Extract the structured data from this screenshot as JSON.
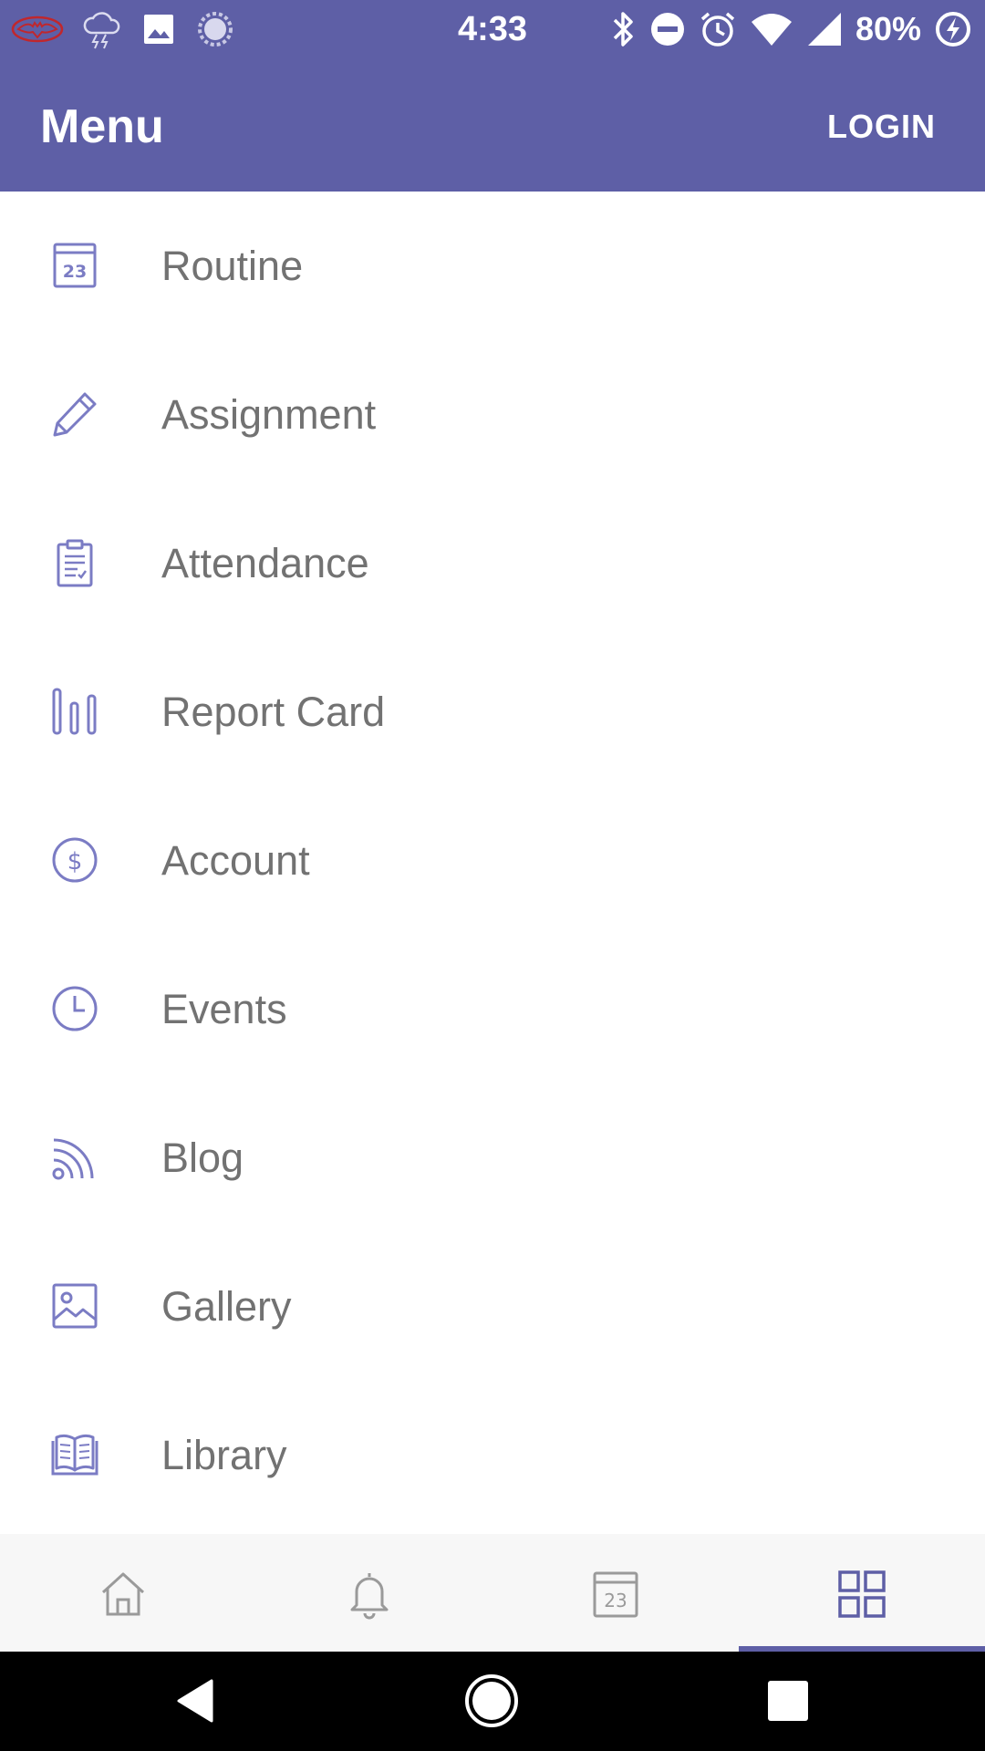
{
  "status_bar": {
    "time": "4:33",
    "battery": "80%",
    "left_icons": [
      "batman-icon",
      "storm-icon",
      "image-icon",
      "sync-icon"
    ],
    "right_icons": [
      "bluetooth-icon",
      "dnd-icon",
      "alarm-icon",
      "wifi-icon",
      "signal-icon",
      "battery-charging-icon"
    ]
  },
  "appbar": {
    "title": "Menu",
    "login_label": "LOGIN"
  },
  "menu": {
    "items": [
      {
        "label": "Routine",
        "icon": "calendar-23-icon"
      },
      {
        "label": "Assignment",
        "icon": "pencil-icon"
      },
      {
        "label": "Attendance",
        "icon": "clipboard-icon"
      },
      {
        "label": "Report Card",
        "icon": "bar-chart-icon"
      },
      {
        "label": "Account",
        "icon": "dollar-circle-icon"
      },
      {
        "label": "Events",
        "icon": "clock-icon"
      },
      {
        "label": "Blog",
        "icon": "rss-icon"
      },
      {
        "label": "Gallery",
        "icon": "image-icon"
      },
      {
        "label": "Library",
        "icon": "book-icon"
      }
    ]
  },
  "bottom_nav": {
    "items": [
      {
        "name": "home",
        "icon": "home-icon"
      },
      {
        "name": "notifications",
        "icon": "bell-icon"
      },
      {
        "name": "calendar",
        "icon": "calendar-23-icon",
        "text": "23"
      },
      {
        "name": "menu",
        "icon": "grid-icon",
        "active": true
      }
    ]
  },
  "calendar_day": "23",
  "colors": {
    "primary": "#5e5fa6",
    "icon": "#7b7cc4",
    "label": "#727272",
    "nav_inactive": "#9a9a9a"
  }
}
